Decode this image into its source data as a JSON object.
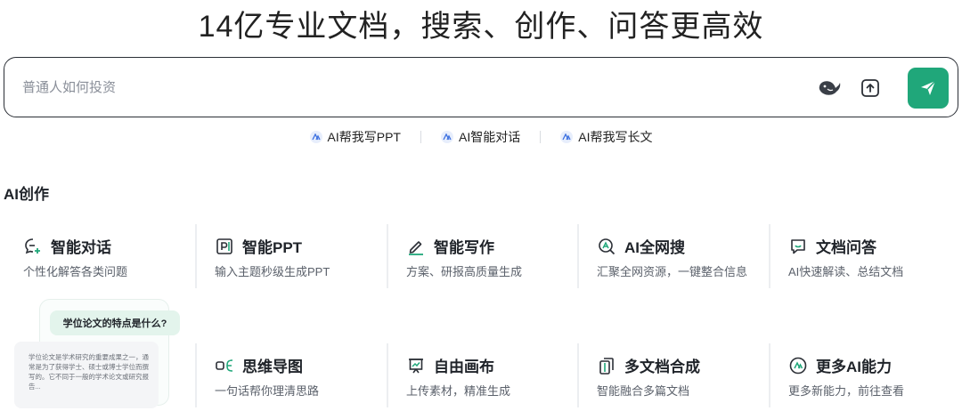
{
  "headline": "14亿专业文档，搜索、创作、问答更高效",
  "search": {
    "placeholder": "普通人如何投资",
    "icons": [
      "deepseek-whale-icon",
      "upload-icon",
      "send-icon"
    ]
  },
  "quick_links": [
    {
      "label": "AI帮我写PPT"
    },
    {
      "label": "AI智能对话"
    },
    {
      "label": "AI帮我写长文"
    }
  ],
  "section": {
    "title": "AI创作"
  },
  "cards": [
    {
      "title": "智能对话",
      "desc": "个性化解答各类问题",
      "icon": "chat-plus-icon"
    },
    {
      "title": "智能PPT",
      "desc": "输入主题秒级生成PPT",
      "icon": "ppt-icon"
    },
    {
      "title": "智能写作",
      "desc": "方案、研报高质量生成",
      "icon": "pen-icon"
    },
    {
      "title": "AI全网搜",
      "desc": "汇聚全网资源，一键整合信息",
      "icon": "web-search-icon"
    },
    {
      "title": "文档问答",
      "desc": "AI快速解读、总结文档",
      "icon": "doc-chat-icon"
    },
    {
      "title": "思维导图",
      "desc": "一句话帮你理清思路",
      "icon": "mindmap-icon"
    },
    {
      "title": "自由画布",
      "desc": "上传素材，精准生成",
      "icon": "canvas-icon"
    },
    {
      "title": "多文档合成",
      "desc": "智能融合多篇文档",
      "icon": "multi-doc-icon"
    },
    {
      "title": "更多AI能力",
      "desc": "更多新能力，前往查看",
      "icon": "more-ai-icon"
    }
  ],
  "preview": {
    "question": "学位论文的特点是什么?",
    "answer": "学位论文是学术研究的重要成果之一，通常是为了获得学士、硕士或博士学位而撰写的。它不同于一般的学术论文或研究报告..."
  },
  "colors": {
    "accent": "#20a77a",
    "text": "#1f2329",
    "muted": "#5b616b"
  }
}
